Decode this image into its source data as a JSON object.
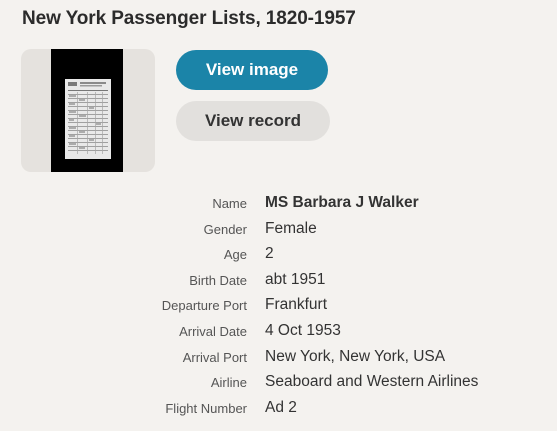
{
  "title": "New York Passenger Lists, 1820-1957",
  "buttons": {
    "view_image": "View image",
    "view_record": "View record"
  },
  "colors": {
    "primary_button": "#1b84a8",
    "secondary_button": "#e2e0dd",
    "background": "#f4f2ef"
  },
  "details": [
    {
      "label": "Name",
      "value": "MS Barbara J Walker"
    },
    {
      "label": "Gender",
      "value": "Female"
    },
    {
      "label": "Age",
      "value": "2"
    },
    {
      "label": "Birth Date",
      "value": "abt 1951"
    },
    {
      "label": "Departure Port",
      "value": "Frankfurt"
    },
    {
      "label": "Arrival Date",
      "value": "4 Oct 1953"
    },
    {
      "label": "Arrival Port",
      "value": "New York, New York, USA"
    },
    {
      "label": "Airline",
      "value": "Seaboard and Western Airlines"
    },
    {
      "label": "Flight Number",
      "value": "Ad 2"
    }
  ]
}
